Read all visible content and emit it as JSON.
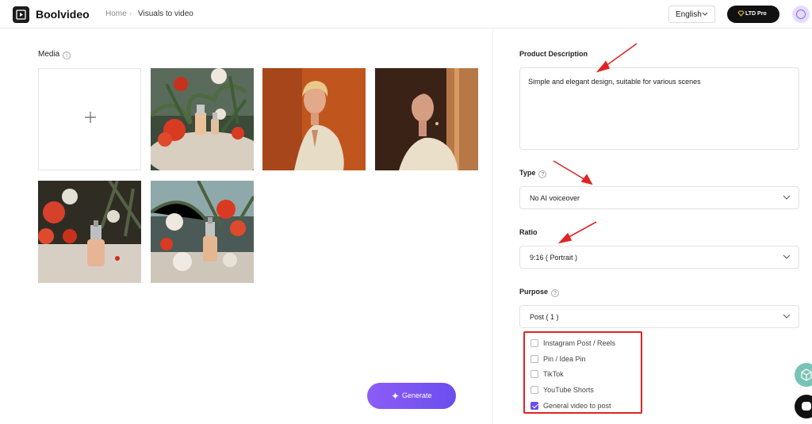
{
  "header": {
    "brand": "Boolvideo",
    "breadcrumb": {
      "home": "Home",
      "separator": "›",
      "current": "Visuals to video"
    },
    "language": "English",
    "pro_label": "LTD Pro"
  },
  "media": {
    "label": "Media",
    "add_icon": "plus-icon",
    "thumbnails": [
      {
        "name": "perfume-flowers-thumbnail"
      },
      {
        "name": "woman-orange-backdrop-thumbnail"
      },
      {
        "name": "woman-window-light-thumbnail"
      },
      {
        "name": "perfume-red-lilies-thumbnail"
      },
      {
        "name": "perfume-white-flowers-thumbnail"
      }
    ]
  },
  "form": {
    "product_description": {
      "label": "Product Description",
      "value": "Simple and elegant design, suitable for various scenes"
    },
    "type": {
      "label": "Type",
      "value": "No AI voiceover"
    },
    "ratio": {
      "label": "Ratio",
      "value": "9:16 ( Portrait )"
    },
    "purpose": {
      "label": "Purpose",
      "value": "Post ( 1 )",
      "options": [
        {
          "label": "Instagram Post / Reels",
          "checked": false
        },
        {
          "label": "Pin / Idea Pin",
          "checked": false
        },
        {
          "label": "TikTok",
          "checked": false
        },
        {
          "label": "YouTube Shorts",
          "checked": false
        },
        {
          "label": "General video to post",
          "checked": true
        }
      ]
    }
  },
  "actions": {
    "generate_label": "Generate"
  },
  "colors": {
    "accent": "#6b4ef0",
    "annotation": "#e02424",
    "header_button": "#111111"
  }
}
